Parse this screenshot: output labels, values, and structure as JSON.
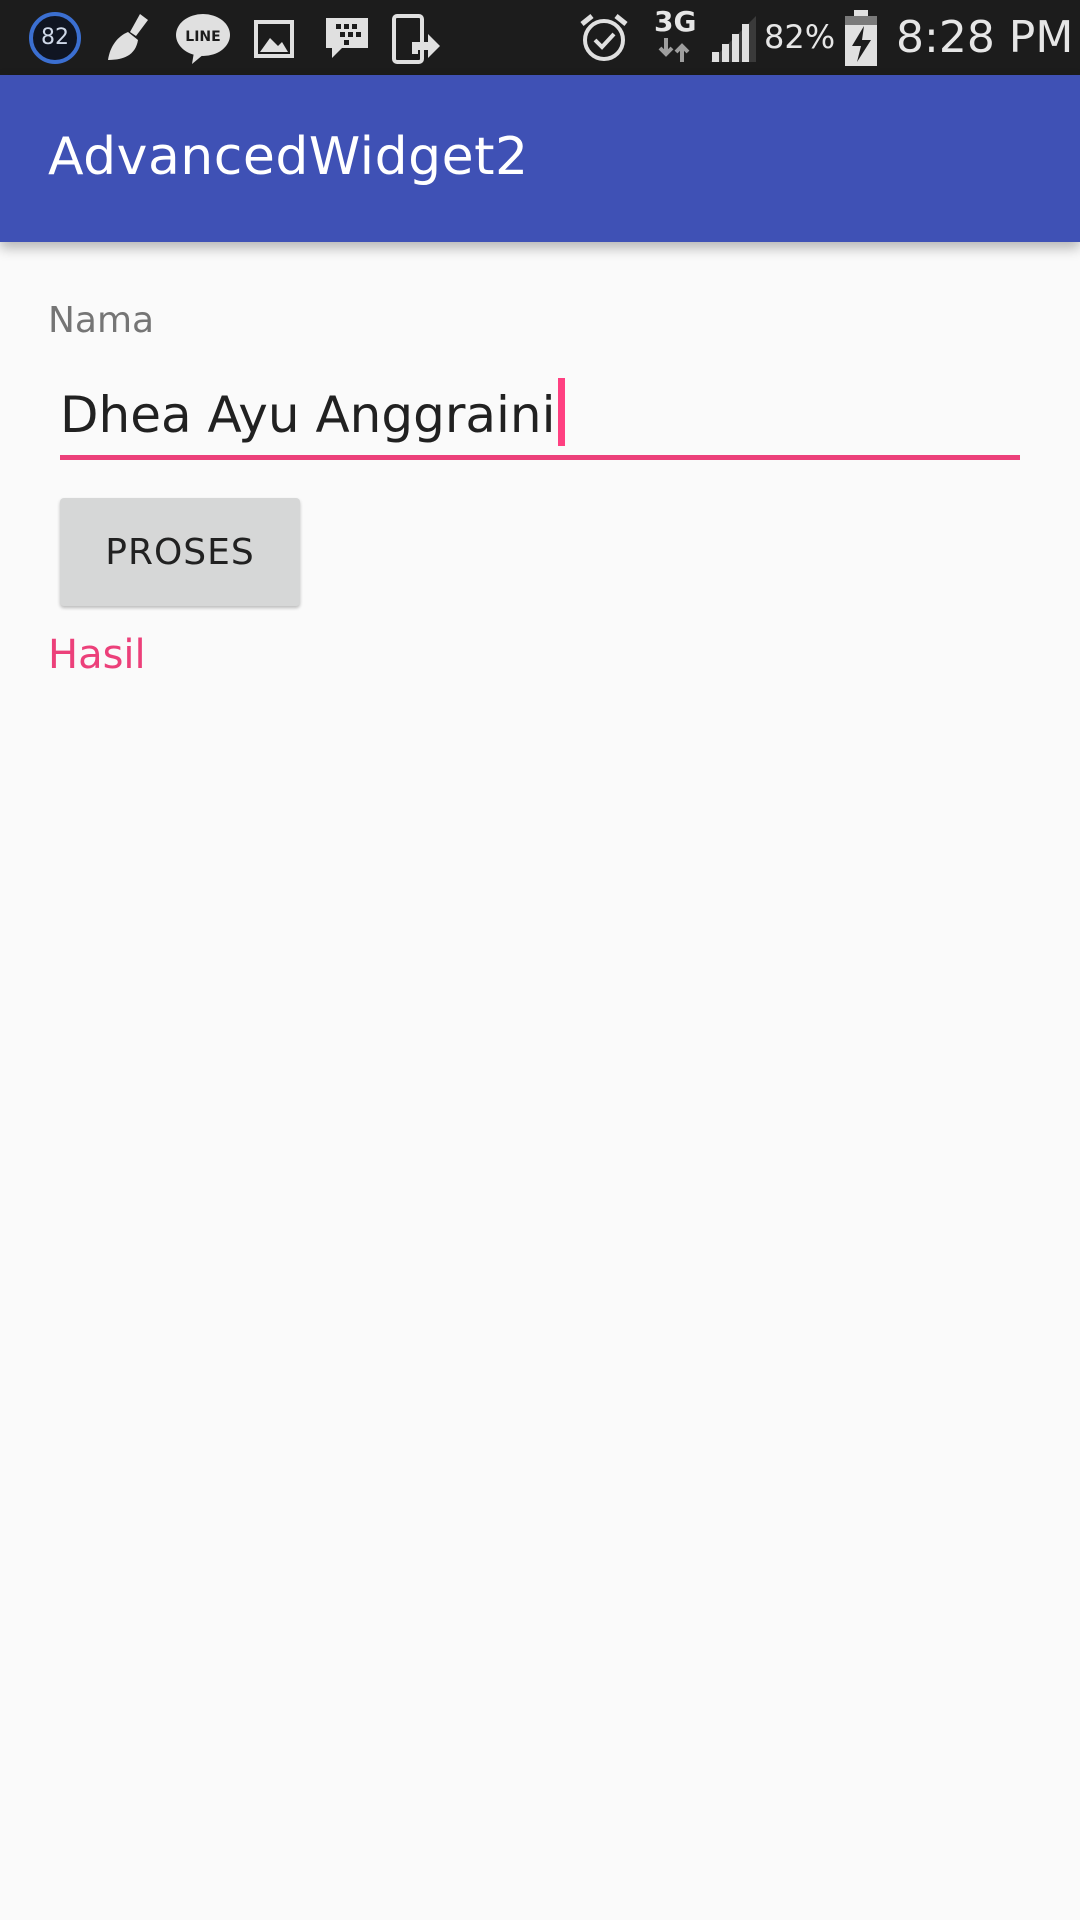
{
  "status_bar": {
    "notification_count": "82",
    "network": "3G",
    "battery_percent": "82%",
    "time": "8:28 PM",
    "left_icons": [
      "badge-icon",
      "cleaner-icon",
      "line-icon",
      "gallery-icon",
      "bbm-icon",
      "phone-share-icon"
    ],
    "right_icons": [
      "alarm-icon",
      "network-arrows-icon",
      "signal-icon",
      "battery-charging-icon"
    ]
  },
  "app_bar": {
    "title": "AdvancedWidget2",
    "color": "#3f51b5"
  },
  "form": {
    "name_label": "Nama",
    "name_value": "Dhea Ayu Anggraini",
    "accent_color": "#ec407a",
    "button_label": "PROSES",
    "result_label": "Hasil"
  }
}
